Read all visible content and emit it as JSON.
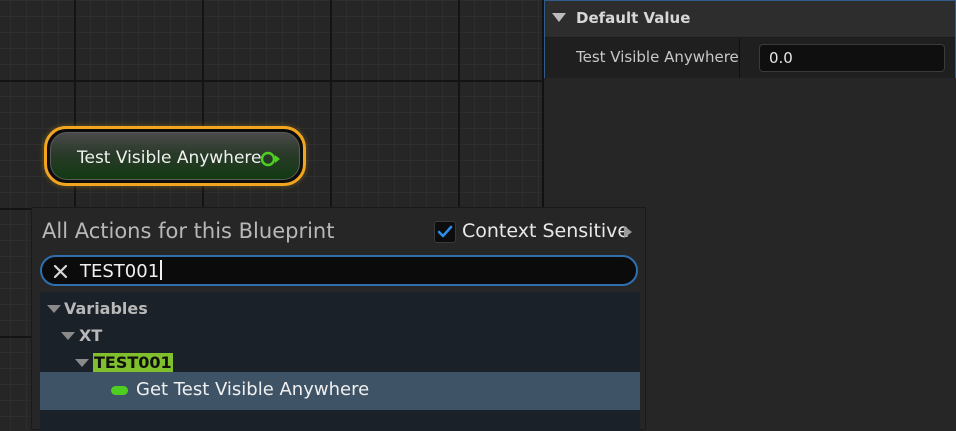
{
  "graph": {
    "variable_node": {
      "label": "Test Visible Anywhere",
      "pin_color": "#4fce22",
      "outline_color": "#f2a51f"
    }
  },
  "details": {
    "section": {
      "title": "Default Value"
    },
    "property": {
      "label": "Test Visible Anywhere",
      "value": "0.0"
    }
  },
  "action_menu": {
    "title": "All Actions for this Blueprint",
    "context_sensitive": {
      "label": "Context Sensitive",
      "checked": true
    },
    "search": {
      "value": "TEST001"
    },
    "tree": {
      "category": "Variables",
      "subcategory": "XT",
      "group": "TEST001",
      "item": "Get Test Visible Anywhere"
    },
    "colors": {
      "accent": "#2f6fae",
      "highlight": "#7fc02c",
      "selected_row": "#3e5366"
    }
  }
}
